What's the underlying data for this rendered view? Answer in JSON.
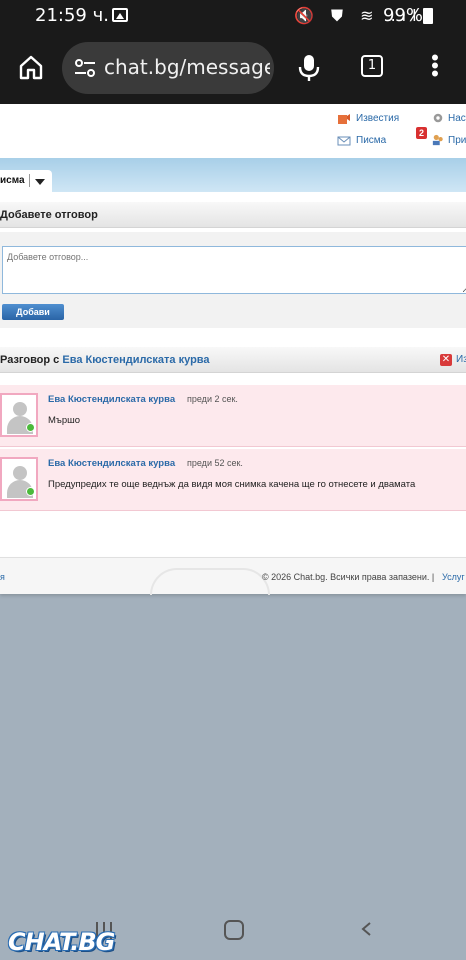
{
  "status_bar": {
    "time": "21:59 ч.",
    "icons": "🔇 ⛊ ≋ .ıl",
    "battery": "99%"
  },
  "browser": {
    "url": "chat.bg/messages/",
    "tab_count": "1"
  },
  "top_nav": {
    "news": "Известия",
    "letters": "Писма",
    "letters_badge": "2",
    "settings": "Наст",
    "friends": "При"
  },
  "tabs": {
    "active": "исма"
  },
  "reply": {
    "heading": "Добавете отговор",
    "placeholder": "Добавете отговор...",
    "button": "Добави"
  },
  "conversation": {
    "prefix": "Разговор с ",
    "partner": "Ева Кюстендилската курва",
    "close_label": "Из",
    "messages": [
      {
        "author": "Ева Кюстендилската курва",
        "time": "преди 2 сек.",
        "text": "Мършо"
      },
      {
        "author": "Ева Кюстендилската курва",
        "time": "преди 52 сек.",
        "text": "Предупредих те още веднъж да видя моя снимка качена ще го отнесете и двамата"
      }
    ]
  },
  "footer": {
    "left": "я",
    "copyright": "© 2026 Chat.bg. Всички права запазени. |",
    "link": "Услуг"
  },
  "watermark": "CHAT.BG",
  "colors": {
    "link": "#2b6aa8",
    "message_bg": "#fde9ed",
    "status_bar": "#1a1a1a",
    "outside_bg": "#a3b0bc"
  }
}
